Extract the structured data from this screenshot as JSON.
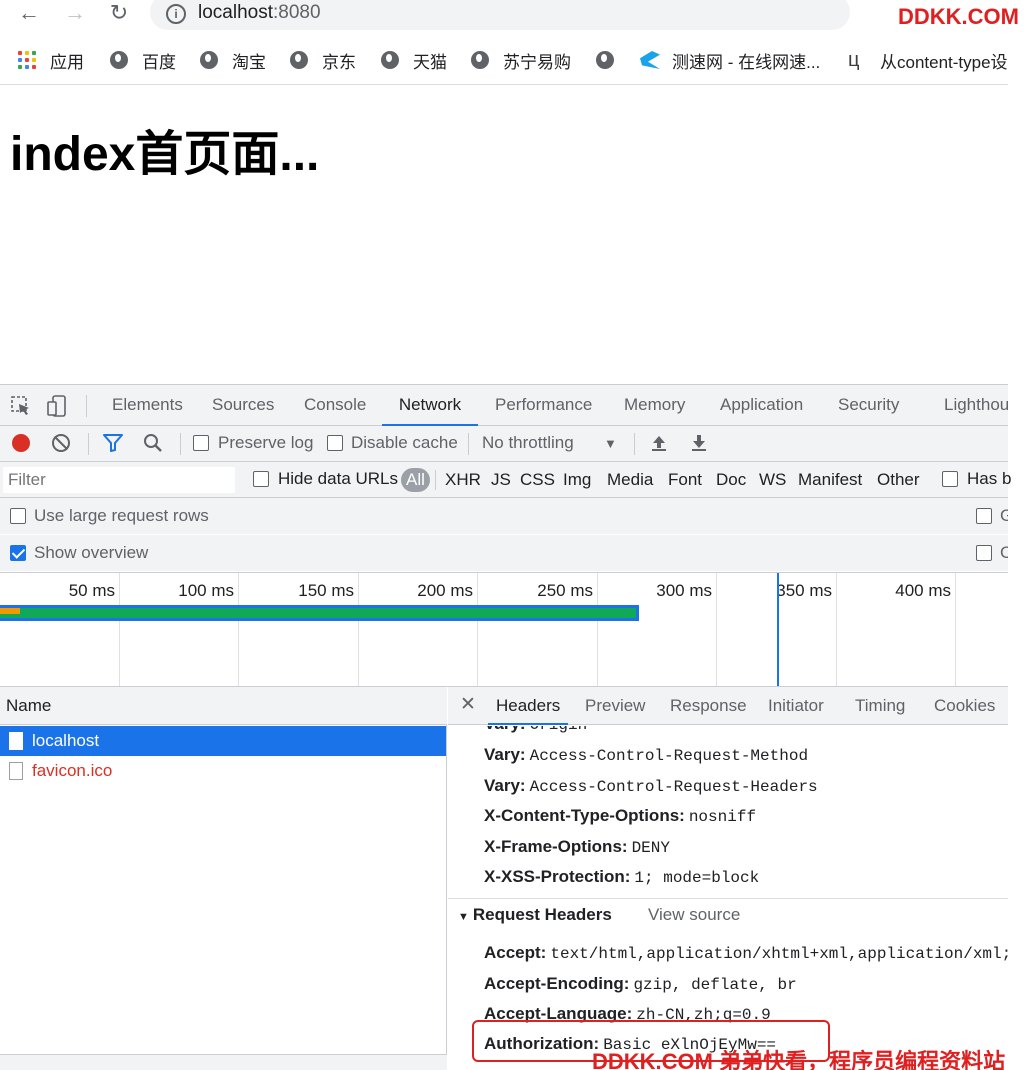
{
  "browser": {
    "url_host": "localhost",
    "url_port": ":8080",
    "watermark_top": "DDKK.COM"
  },
  "bookmarks": [
    {
      "label": "应用",
      "icon": "apps-grid-icon"
    },
    {
      "label": "百度",
      "icon": "globe-icon"
    },
    {
      "label": "淘宝",
      "icon": "globe-icon"
    },
    {
      "label": "京东",
      "icon": "globe-icon"
    },
    {
      "label": "天猫",
      "icon": "globe-icon"
    },
    {
      "label": "苏宁易购",
      "icon": "globe-icon"
    },
    {
      "label": "",
      "icon": "globe-icon"
    },
    {
      "label": "测速网 - 在线网速...",
      "icon": "speedtest-icon"
    },
    {
      "label": "从content-type设",
      "icon": "bookmark-logo-icon"
    }
  ],
  "page": {
    "heading": "index首页面..."
  },
  "devtools": {
    "tabs": [
      "Elements",
      "Sources",
      "Console",
      "Network",
      "Performance",
      "Memory",
      "Application",
      "Security",
      "Lighthouse"
    ],
    "active_tab": "Network",
    "toolbar": {
      "preserve_log": "Preserve log",
      "disable_cache": "Disable cache",
      "throttling": "No throttling"
    },
    "filter": {
      "placeholder": "Filter",
      "hide_data_urls": "Hide data URLs",
      "types": [
        "All",
        "XHR",
        "JS",
        "CSS",
        "Img",
        "Media",
        "Font",
        "Doc",
        "WS",
        "Manifest",
        "Other"
      ],
      "active_type": "All",
      "has_blocked": "Has b"
    },
    "options": {
      "use_large_rows": "Use large request rows",
      "use_large_rows_checked": false,
      "show_overview": "Show overview",
      "show_overview_checked": true
    },
    "overview": {
      "ticks": [
        "50 ms",
        "100 ms",
        "150 ms",
        "200 ms",
        "250 ms",
        "300 ms",
        "350 ms",
        "400 ms"
      ],
      "request_end_ms": 270,
      "load_event_ms": 352
    },
    "requests": {
      "column": "Name",
      "rows": [
        {
          "name": "localhost",
          "selected": true,
          "status": "ok"
        },
        {
          "name": "favicon.ico",
          "selected": false,
          "status": "error"
        }
      ]
    },
    "detail": {
      "tabs": [
        "Headers",
        "Preview",
        "Response",
        "Initiator",
        "Timing",
        "Cookies"
      ],
      "active_tab": "Headers",
      "response_headers": [
        {
          "key": "Vary:",
          "value": "Origin"
        },
        {
          "key": "Vary:",
          "value": "Access-Control-Request-Method"
        },
        {
          "key": "Vary:",
          "value": "Access-Control-Request-Headers"
        },
        {
          "key": "X-Content-Type-Options:",
          "value": "nosniff"
        },
        {
          "key": "X-Frame-Options:",
          "value": "DENY"
        },
        {
          "key": "X-XSS-Protection:",
          "value": "1; mode=block"
        }
      ],
      "request_section_title": "Request Headers",
      "view_source": "View source",
      "request_headers": [
        {
          "key": "Accept:",
          "value": "text/html,application/xhtml+xml,application/xml;q"
        },
        {
          "key": "Accept-Encoding:",
          "value": "gzip, deflate, br"
        },
        {
          "key": "Accept-Language:",
          "value": "zh-CN,zh;q=0.9"
        },
        {
          "key": "Authorization:",
          "value": "Basic eXlnOjEyMw=="
        }
      ]
    }
  },
  "watermark_bottom": "DDKK.COM 弟弟快看，程序员编程资料站",
  "colors": {
    "accent": "#1a73e8",
    "record": "#d93025",
    "error_text": "#d93025",
    "highlight_box": "#e02020",
    "bar_green": "#0fa958",
    "bar_orange": "#f29900"
  }
}
